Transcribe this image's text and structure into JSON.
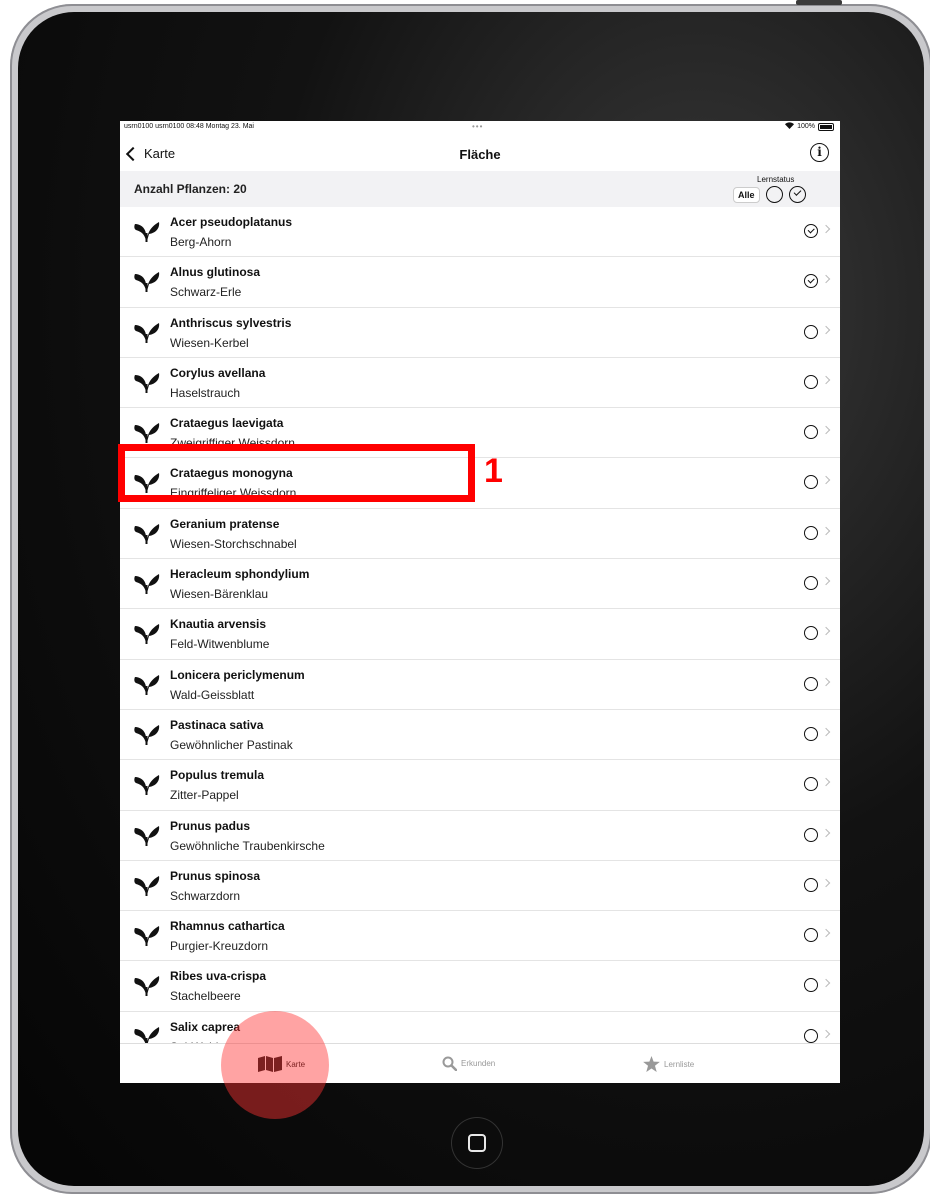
{
  "status_bar": {
    "left_text": "usrn0100 usrn0100  08:48  Montag 23. Mai",
    "center_dots": "•••",
    "right_text": "100%"
  },
  "nav": {
    "back_label": "Karte",
    "title": "Fläche",
    "info_icon": "info-icon"
  },
  "subheader": {
    "count_label": "Anzahl Pflanzen: 20",
    "lernstatus_label": "Lernstatus",
    "filter_all_label": "Alle"
  },
  "plants": [
    {
      "scientific": "Acer pseudoplatanus",
      "common": "Berg-Ahorn",
      "status": "learned"
    },
    {
      "scientific": "Alnus glutinosa",
      "common": "Schwarz-Erle",
      "status": "learned"
    },
    {
      "scientific": "Anthriscus sylvestris",
      "common": "Wiesen-Kerbel",
      "status": "open"
    },
    {
      "scientific": "Corylus avellana",
      "common": "Haselstrauch",
      "status": "open"
    },
    {
      "scientific": "Crataegus laevigata",
      "common": "Zweigriffiger Weissdorn",
      "status": "open"
    },
    {
      "scientific": "Crataegus monogyna",
      "common": "Eingriffeliger Weissdorn",
      "status": "open"
    },
    {
      "scientific": "Geranium pratense",
      "common": "Wiesen-Storchschnabel",
      "status": "open"
    },
    {
      "scientific": "Heracleum sphondylium",
      "common": "Wiesen-Bärenklau",
      "status": "open"
    },
    {
      "scientific": "Knautia arvensis",
      "common": "Feld-Witwenblume",
      "status": "open"
    },
    {
      "scientific": "Lonicera periclymenum",
      "common": "Wald-Geissblatt",
      "status": "open"
    },
    {
      "scientific": "Pastinaca sativa",
      "common": "Gewöhnlicher Pastinak",
      "status": "open"
    },
    {
      "scientific": "Populus tremula",
      "common": "Zitter-Pappel",
      "status": "open"
    },
    {
      "scientific": "Prunus padus",
      "common": "Gewöhnliche Traubenkirsche",
      "status": "open"
    },
    {
      "scientific": "Prunus spinosa",
      "common": "Schwarzdorn",
      "status": "open"
    },
    {
      "scientific": "Rhamnus cathartica",
      "common": "Purgier-Kreuzdorn",
      "status": "open"
    },
    {
      "scientific": "Ribes uva-crispa",
      "common": "Stachelbeere",
      "status": "open"
    },
    {
      "scientific": "Salix caprea",
      "common": "Sal-Weide",
      "status": "open"
    }
  ],
  "tabbar": {
    "tabs": [
      {
        "label": "Karte",
        "icon": "map-icon",
        "active": true
      },
      {
        "label": "Erkunden",
        "icon": "search-icon",
        "active": false
      },
      {
        "label": "Lernliste",
        "icon": "star-icon",
        "active": false
      }
    ]
  },
  "annotation": {
    "label": "1"
  }
}
